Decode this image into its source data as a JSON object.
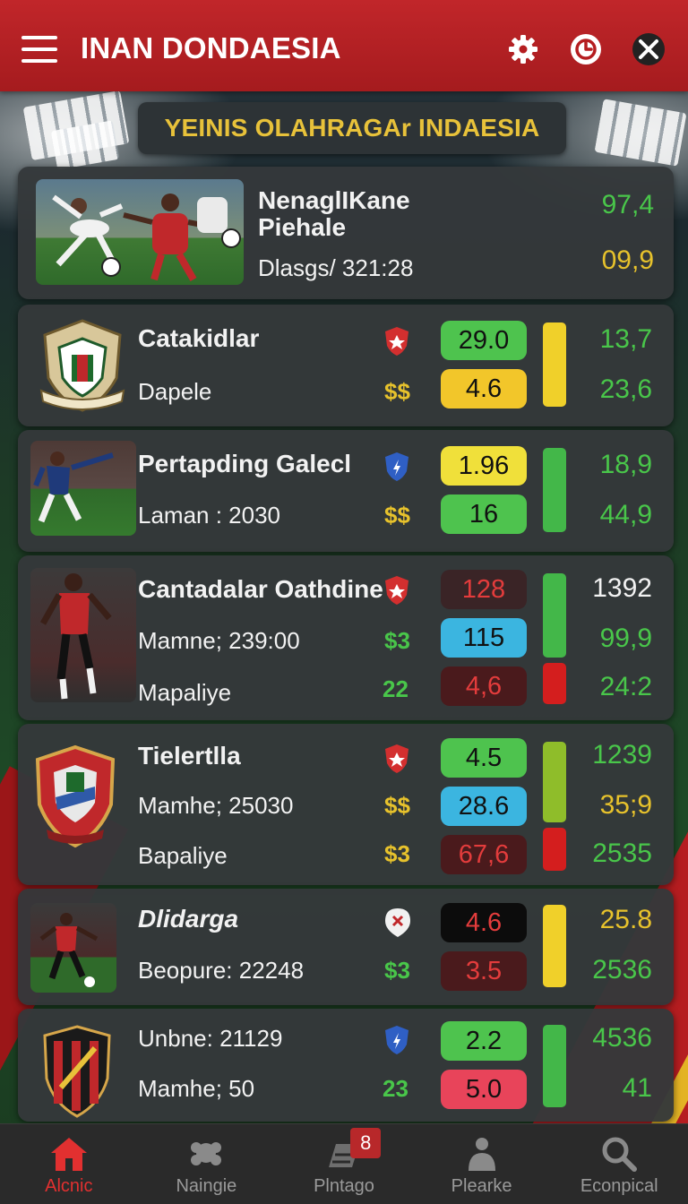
{
  "app": {
    "title": "INAN DONDAESIA",
    "banner": "YEINIS OLAHRAGAr INDAESIA"
  },
  "colors": {
    "header_red": "#b51d20",
    "accent_gold": "#e7c22c",
    "green": "#49c64a",
    "yellow": "#f0d02a",
    "blue": "#3bb5e0",
    "dark_red": "#4a1a1a",
    "card_bg": "#34383a"
  },
  "header_icons": [
    "menu-icon",
    "gear-icon",
    "clock-icon",
    "cross-icon"
  ],
  "featured": {
    "title_line1": "NenaglIKane",
    "title_line2": "Piehale",
    "subtitle": "Dlasgs/  321:28",
    "value_top": "97,4",
    "value_bottom": "09,9"
  },
  "matches": [
    {
      "title": "Catakidlar",
      "line2": "Dapele",
      "cur1": "$$",
      "odd1": "29.0",
      "odd2": "4.6",
      "r1": "13,7",
      "r2": "23,6"
    },
    {
      "title": "Pertapding Galecl",
      "line2": "Laman : 2030",
      "cur1": "$$",
      "odd1": "1.96",
      "odd2": "16",
      "r1": "18,9",
      "r2": "44,9"
    },
    {
      "title": "Cantadalar Oathdine",
      "line2": "Mamne; 239:00",
      "line3": "Mapaliye",
      "cur1": "$3",
      "cur2": "22",
      "odd1": "128",
      "odd2": "115",
      "odd3": "4,6",
      "r1": "1392",
      "r2": "99,9",
      "r3": "24:2"
    },
    {
      "title": "Tielertlla",
      "line2": "Mamhe; 25030",
      "line3": "Bapaliye",
      "cur1": "$$",
      "cur2": "$3",
      "odd1": "4.5",
      "odd2": "28.6",
      "odd3": "67,6",
      "r1": "1239",
      "r2": "35;9",
      "r3": "2535"
    },
    {
      "title": "Dlidarga",
      "line2": "Beopure: 22248",
      "cur1": "$3",
      "odd1": "4.6",
      "odd2": "3.5",
      "r1": "25.8",
      "r2": "2536"
    },
    {
      "title": "Unbne: 21129",
      "line2": "Mamhe; 50",
      "cur1": "23",
      "odd1": "2.2",
      "odd2": "5.0",
      "r1": "4536",
      "r2": "41"
    }
  ],
  "nav": {
    "items": [
      {
        "label": "Alcnic",
        "icon": "home-icon"
      },
      {
        "label": "Naingie",
        "icon": "group-icon"
      },
      {
        "label": "Plntago",
        "icon": "ticket-icon"
      },
      {
        "label": "Plearke",
        "icon": "person-icon"
      },
      {
        "label": "Econpical",
        "icon": "search-icon"
      }
    ],
    "badge": "8"
  }
}
